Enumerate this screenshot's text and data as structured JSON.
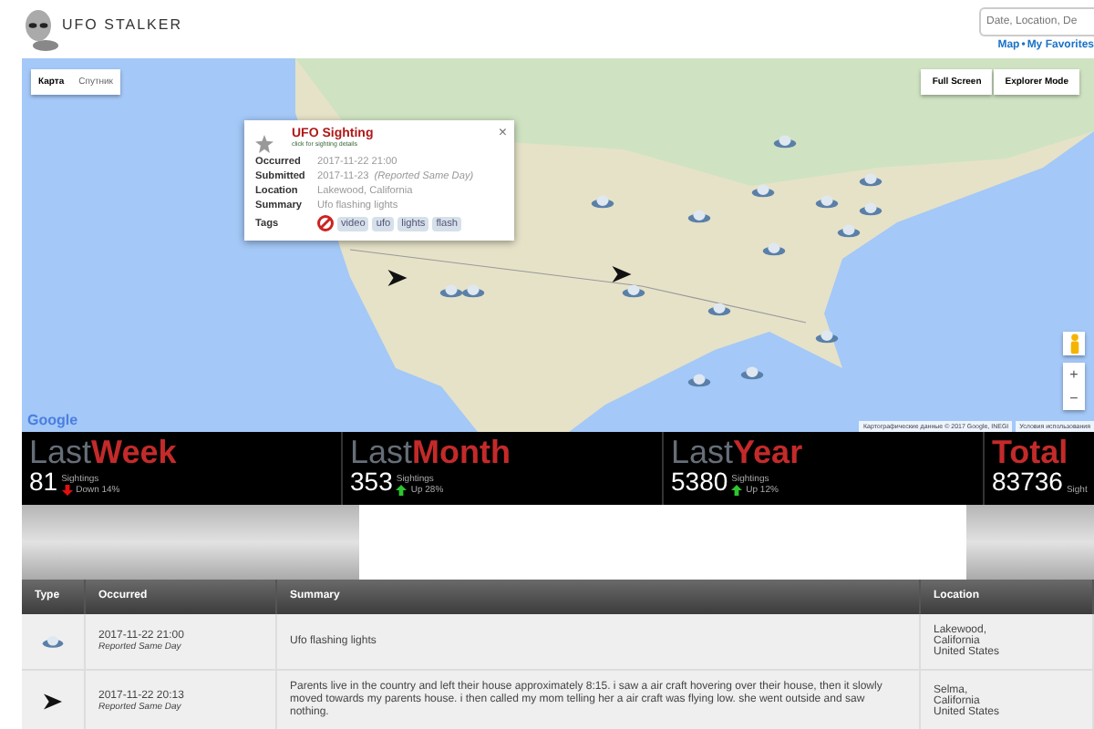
{
  "header": {
    "logo_text": "UFO STALKER",
    "search": {
      "placeholder": "Date, Location, De"
    },
    "links": [
      {
        "label": "Map"
      },
      {
        "label": "My Favorites"
      }
    ],
    "link_separator": "•"
  },
  "map": {
    "type_buttons": [
      {
        "label": "Карта",
        "selected": true
      },
      {
        "label": "Спутник",
        "selected": false
      }
    ],
    "mode_buttons": [
      {
        "label": "Full Screen"
      },
      {
        "label": "Explorer Mode"
      }
    ],
    "zoom_in": "+",
    "zoom_out": "−",
    "attribution": "Картографические данные © 2017 Google, INEGI",
    "terms": "Условия использования",
    "google_logo": "Google",
    "markers": [
      {
        "kind": "ufo"
      },
      {
        "kind": "ufo"
      },
      {
        "kind": "ufo"
      },
      {
        "kind": "ufo"
      },
      {
        "kind": "ufo"
      },
      {
        "kind": "ufo"
      },
      {
        "kind": "ufo"
      },
      {
        "kind": "ufo"
      },
      {
        "kind": "ufo"
      },
      {
        "kind": "ufo"
      },
      {
        "kind": "ufo"
      },
      {
        "kind": "ufo"
      },
      {
        "kind": "ufo"
      },
      {
        "kind": "ufo"
      },
      {
        "kind": "ufo"
      },
      {
        "kind": "ufo"
      },
      {
        "kind": "arrow"
      },
      {
        "kind": "arrow"
      }
    ],
    "popup": {
      "title": "UFO Sighting",
      "subtitle": "click for sighting details",
      "close": "×",
      "fields": [
        {
          "label": "Occurred",
          "value": "2017-11-22 21:00"
        },
        {
          "label": "Submitted",
          "value": "2017-11-23",
          "note": "(Reported Same Day)"
        },
        {
          "label": "Location",
          "value": "Lakewood, California"
        },
        {
          "label": "Summary",
          "value": "Ufo flashing lights"
        }
      ],
      "tags_label": "Tags",
      "tags": [
        "video",
        "ufo",
        "lights",
        "flash"
      ]
    }
  },
  "stats": [
    {
      "prefix": "Last",
      "period": "Week",
      "count": "81",
      "unit": "Sightings",
      "kind": "down",
      "change": "Down 14%"
    },
    {
      "prefix": "Last",
      "period": "Month",
      "count": "353",
      "unit": "Sightings",
      "kind": "up",
      "change": "Up 28%"
    },
    {
      "prefix": "Last",
      "period": "Year",
      "count": "5380",
      "unit": "Sightings",
      "kind": "up",
      "change": "Up 12%"
    },
    {
      "period": "Total",
      "count": "83736",
      "unit": "Sight"
    }
  ],
  "table": {
    "columns": [
      "Type",
      "Occurred",
      "Summary",
      "Location"
    ],
    "rows": [
      {
        "kind": "ufo",
        "occurred": "2017-11-22 21:00",
        "reported": "Reported Same Day",
        "summary": "Ufo flashing lights",
        "location": [
          "Lakewood,",
          "California",
          "United States"
        ]
      },
      {
        "kind": "arrow",
        "occurred": "2017-11-22 20:13",
        "reported": "Reported Same Day",
        "summary": "Parents live in the country and left their house approximately 8:15. i saw a air craft hovering over their house, then it slowly moved towards my parents house. i then called my mom telling her a air craft was flying low. she went outside and saw nothing.",
        "location": [
          "Selma,",
          "California",
          "United States"
        ]
      }
    ]
  }
}
